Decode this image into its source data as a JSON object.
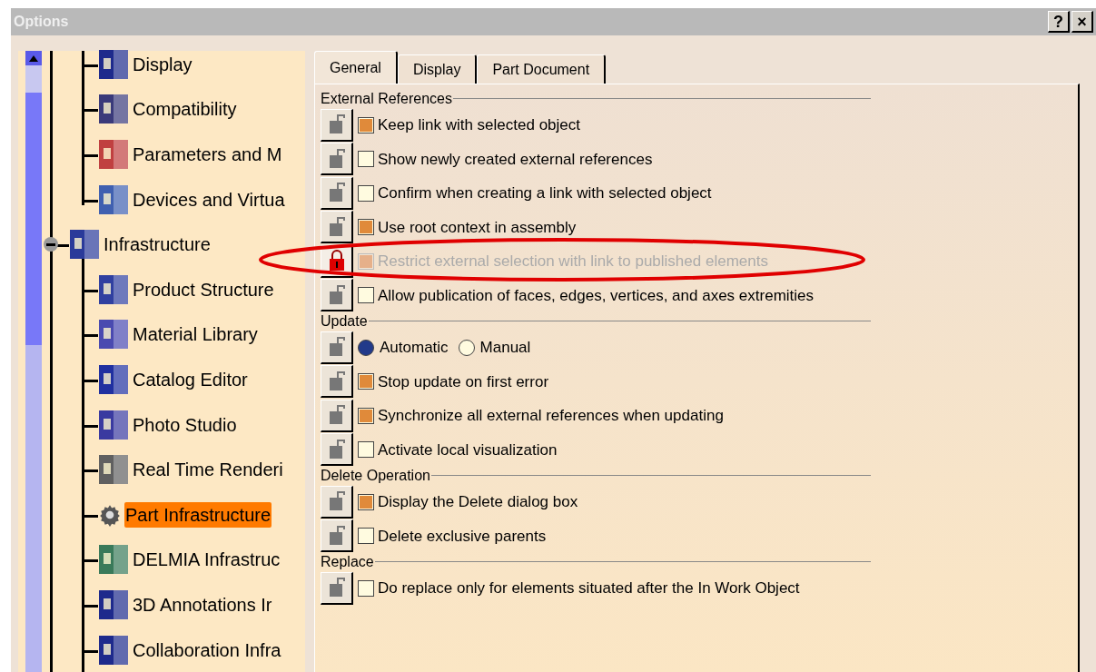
{
  "window": {
    "title": "Options",
    "buttons": [
      "?",
      "×"
    ]
  },
  "tree": [
    {
      "children": [
        {
          "label": "Display",
          "selected": false
        },
        {
          "label": "Compatibility",
          "selected": false
        },
        {
          "label": "Parameters and M",
          "selected": false
        },
        {
          "label": "Devices and Virtua",
          "selected": false
        }
      ]
    },
    {
      "label": "Infrastructure",
      "expanded": true,
      "selected": false,
      "children": [
        {
          "label": "Product Structure",
          "selected": false
        },
        {
          "label": "Material Library",
          "selected": false
        },
        {
          "label": "Catalog Editor",
          "selected": false
        },
        {
          "label": "Photo Studio",
          "selected": false
        },
        {
          "label": "Real Time Renderi",
          "selected": false
        },
        {
          "label": "Part Infrastructure",
          "selected": true
        },
        {
          "label": "DELMIA Infrastruc",
          "selected": false
        },
        {
          "label": "3D Annotations Ir",
          "selected": false
        },
        {
          "label": "Collaboration Infra",
          "selected": false
        }
      ]
    }
  ],
  "tabs": [
    {
      "label": "General",
      "selected": true
    },
    {
      "label": "Display",
      "selected": false
    },
    {
      "label": "Part Document",
      "selected": false
    }
  ],
  "groups": [
    {
      "title": "External References",
      "rows": [
        {
          "kind": "checkbox",
          "locked": false,
          "options": [
            {
              "label": "Keep link with selected object",
              "checked": true,
              "disabled": false
            }
          ]
        },
        {
          "kind": "checkbox",
          "locked": false,
          "options": [
            {
              "label": "Show newly created external references",
              "checked": false,
              "disabled": false
            }
          ]
        },
        {
          "kind": "checkbox",
          "locked": false,
          "options": [
            {
              "label": "Confirm when creating a link with selected object",
              "checked": false,
              "disabled": false
            }
          ]
        },
        {
          "kind": "checkbox",
          "locked": false,
          "options": [
            {
              "label": "Use root context in assembly",
              "checked": true,
              "disabled": false
            }
          ]
        },
        {
          "kind": "checkbox",
          "locked": true,
          "options": [
            {
              "label": "Restrict external selection with link to published elements",
              "checked": true,
              "disabled": true
            }
          ]
        },
        {
          "kind": "checkbox",
          "locked": false,
          "options": [
            {
              "label": "Allow publication of faces, edges, vertices, and axes extremities",
              "checked": false,
              "disabled": false
            }
          ]
        }
      ]
    },
    {
      "title": "Update",
      "rows": [
        {
          "kind": "radio",
          "locked": false,
          "options": [
            {
              "label": "Automatic",
              "selected": true
            },
            {
              "label": "Manual",
              "selected": false
            }
          ]
        },
        {
          "kind": "checkbox",
          "locked": false,
          "options": [
            {
              "label": "Stop update on first error",
              "checked": true,
              "disabled": false
            }
          ]
        },
        {
          "kind": "checkbox",
          "locked": false,
          "options": [
            {
              "label": "Synchronize all external references when updating",
              "checked": true,
              "disabled": false
            }
          ]
        },
        {
          "kind": "checkbox",
          "locked": false,
          "options": [
            {
              "label": "Activate local visualization",
              "checked": false,
              "disabled": false
            }
          ]
        }
      ]
    },
    {
      "title": "Delete Operation",
      "rows": [
        {
          "kind": "checkbox",
          "locked": false,
          "options": [
            {
              "label": "Display the Delete dialog box",
              "checked": true,
              "disabled": false
            }
          ]
        },
        {
          "kind": "checkbox",
          "locked": false,
          "options": [
            {
              "label": "Delete exclusive parents",
              "checked": false,
              "disabled": false
            }
          ]
        }
      ]
    },
    {
      "title": "Replace",
      "rows": [
        {
          "kind": "checkbox",
          "locked": false,
          "options": [
            {
              "label": "Do replace only for elements situated after the In Work Object",
              "checked": false,
              "disabled": false
            }
          ]
        }
      ]
    }
  ]
}
